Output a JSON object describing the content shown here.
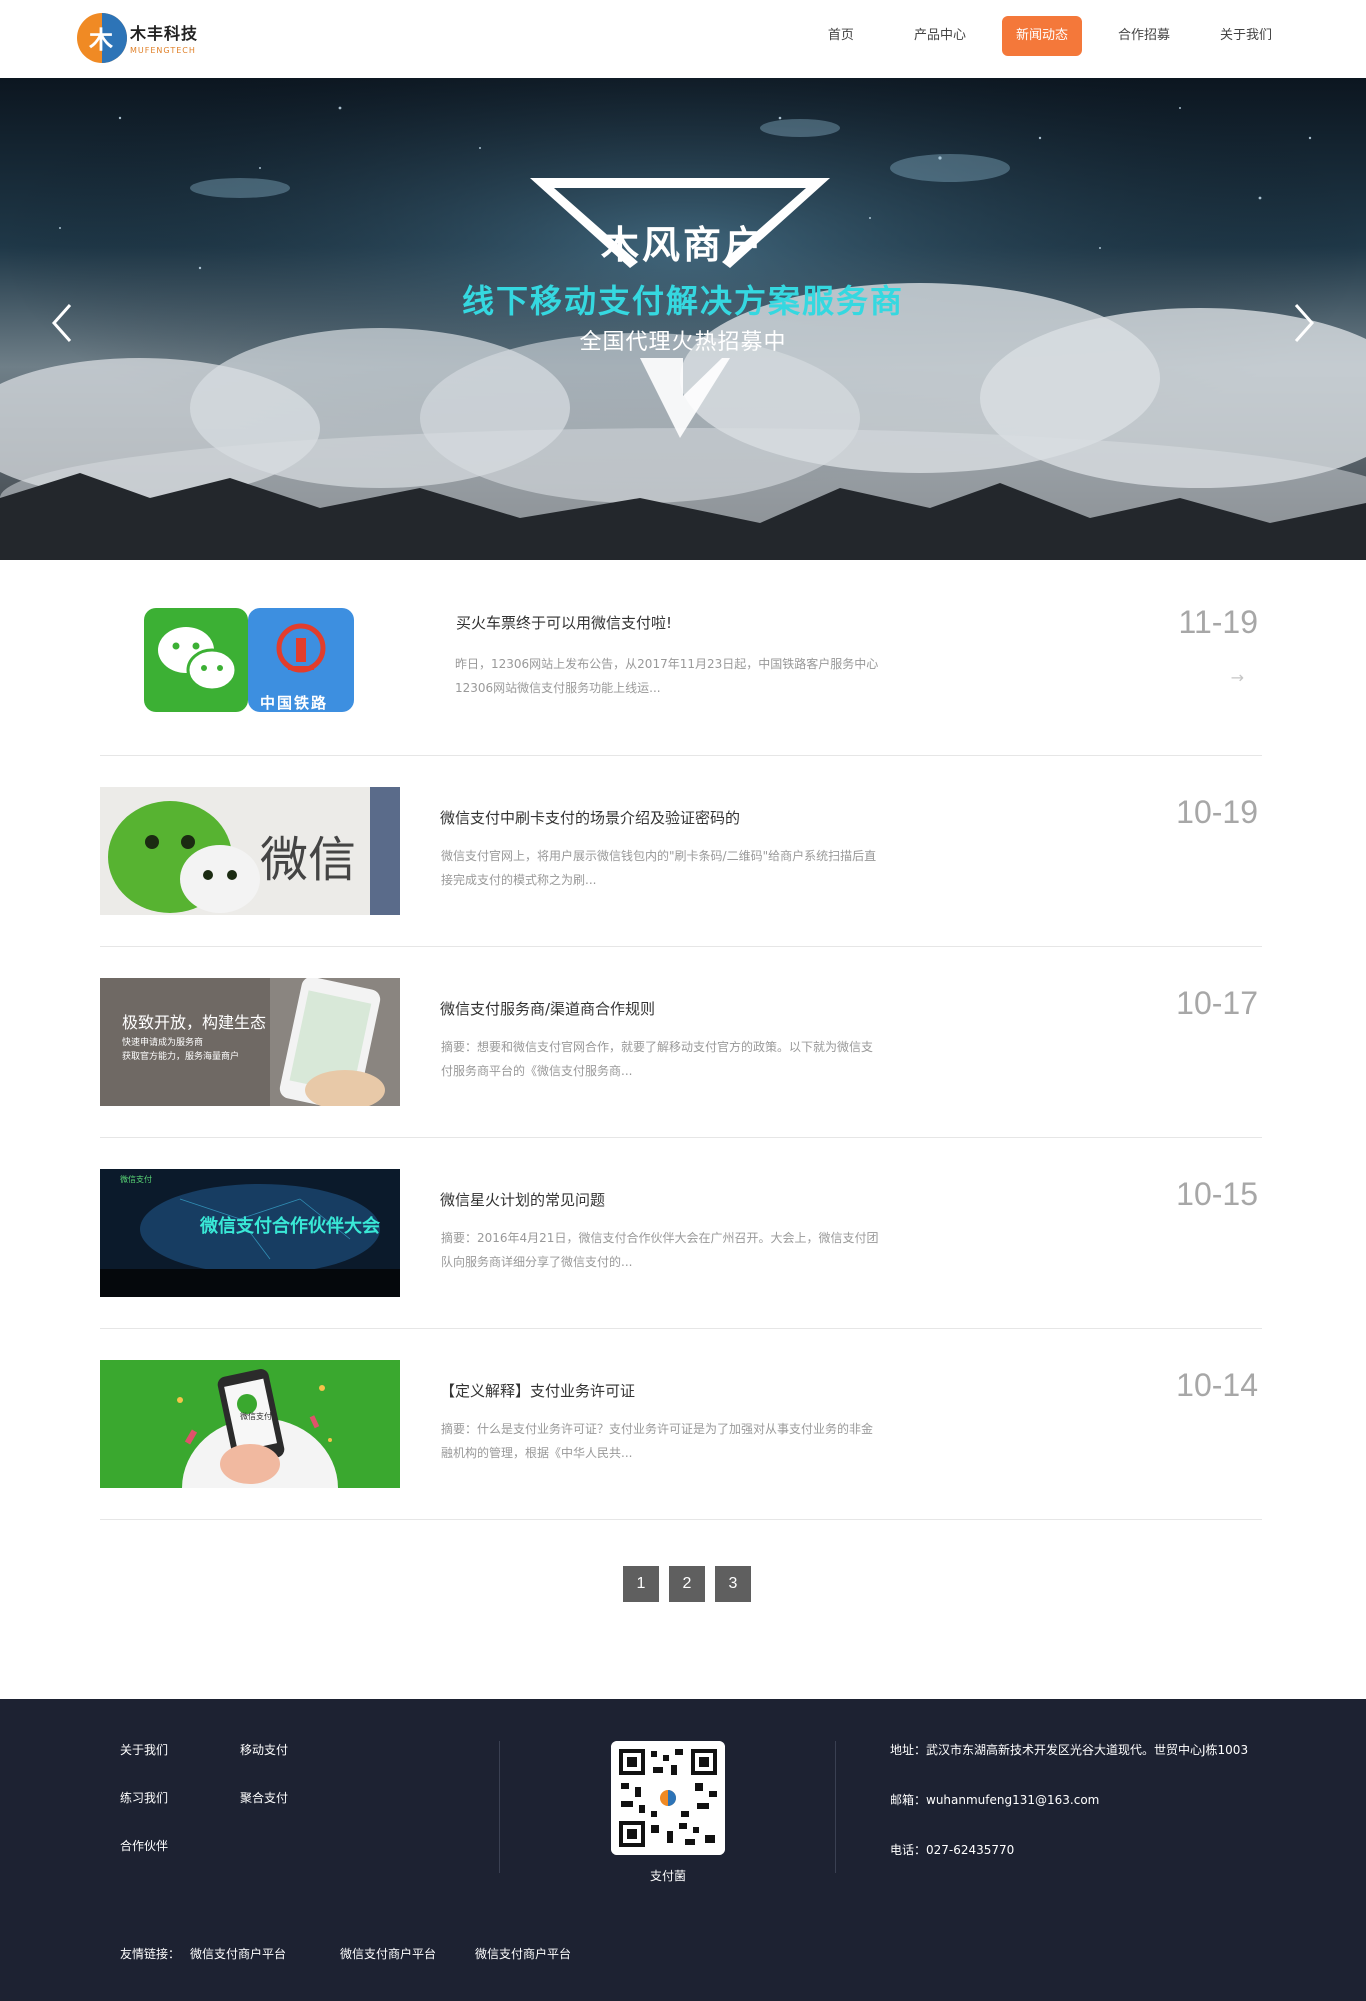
{
  "header": {
    "logo_cn": "木丰科技",
    "logo_en": "MUFENGTECH",
    "nav": [
      {
        "label": "首页",
        "active": false
      },
      {
        "label": "产品中心",
        "active": false
      },
      {
        "label": "新闻动态",
        "active": true
      },
      {
        "label": "合作招募",
        "active": false
      },
      {
        "label": "关于我们",
        "active": false
      }
    ]
  },
  "banner": {
    "title": "木风商户",
    "subtitle": "线下移动支付解决方案服务商",
    "subtitle2": "全国代理火热招募中",
    "prev_icon": "chevron-left-icon",
    "next_icon": "chevron-right-icon"
  },
  "news": [
    {
      "title": "买火车票终于可以用微信支付啦!",
      "summary": "昨日，12306网站上发布公告，从2017年11月23日起，中国铁路客户服务中心12306网站微信支付服务功能上线运...",
      "date": "11-19",
      "thumb_text": "中国铁路"
    },
    {
      "title": "微信支付中刷卡支付的场景介绍及验证密码的",
      "summary": "微信支付官网上，将用户展示微信钱包内的\"刷卡条码/二维码\"给商户系统扫描后直接完成支付的模式称之为刷...",
      "date": "10-19",
      "thumb_text": "微信"
    },
    {
      "title": "微信支付服务商/渠道商合作规则",
      "summary": "摘要：想要和微信支付官网合作，就要了解移动支付官方的政策。以下就为微信支付服务商平台的《微信支付服务商...",
      "date": "10-17",
      "thumb_text": "极致开放，构建生态",
      "thumb_text2": "快速申请成为服务商",
      "thumb_text3": "获取官方能力，服务海量商户"
    },
    {
      "title": "微信星火计划的常见问题",
      "summary": "摘要：2016年4月21日，微信支付合作伙伴大会在广州召开。大会上，微信支付团队向服务商详细分享了微信支付的...",
      "date": "10-15",
      "thumb_text": "微信支付合作伙伴大会",
      "thumb_text2": "微信支付"
    },
    {
      "title": "【定义解释】支付业务许可证",
      "summary": "摘要：什么是支付业务许可证？支付业务许可证是为了加强对从事支付业务的非金融机构的管理，根据《中华人民共...",
      "date": "10-14",
      "thumb_text": "微信支付"
    }
  ],
  "pagination": [
    "1",
    "2",
    "3"
  ],
  "footer": {
    "links_col1": [
      "关于我们",
      "练习我们",
      "合作伙伴"
    ],
    "links_col2": [
      "移动支付",
      "聚合支付"
    ],
    "qr_label": "支付菌",
    "address": "地址：武汉市东湖高新技术开发区光谷大道现代。世贸中心J栋1003",
    "email": "邮箱：wuhanmufeng131@163.com",
    "phone": "电话：027-62435770",
    "friend_label": "友情链接：",
    "friend_links": [
      "微信支付商户平台",
      "微信支付商户平台",
      "微信支付商户平台"
    ]
  }
}
